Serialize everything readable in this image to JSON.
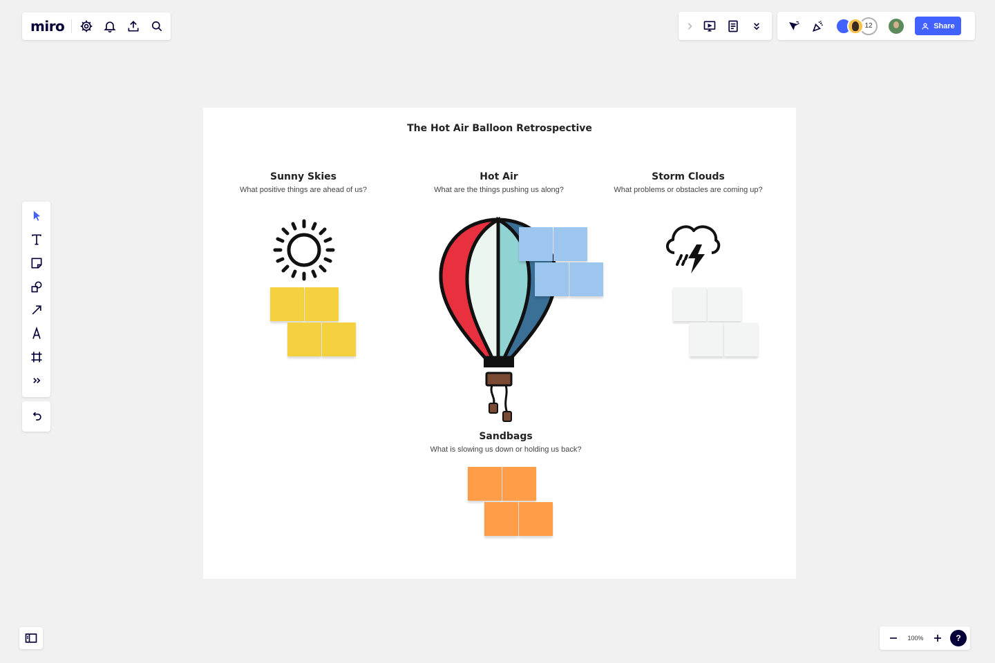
{
  "app": {
    "logo": "miro"
  },
  "toolbar": {
    "settings_icon": "gear-icon",
    "notifications_icon": "bell-icon",
    "export_icon": "upload-icon",
    "search_icon": "search-icon"
  },
  "collab": {
    "extra_count": "12",
    "share_label": "Share"
  },
  "zoom": {
    "value": "100%",
    "help": "?"
  },
  "board": {
    "title": "The Hot Air Balloon Retrospective",
    "sections": {
      "sunny": {
        "title": "Sunny Skies",
        "subtitle": "What positive things are ahead of us?"
      },
      "hotair": {
        "title": "Hot Air",
        "subtitle": "What are the things pushing us along?"
      },
      "storm": {
        "title": "Storm Clouds",
        "subtitle": "What problems or obstacles are coming up?"
      },
      "sandbags": {
        "title": "Sandbags",
        "subtitle": "What is slowing us down or holding us back?"
      }
    }
  },
  "colors": {
    "accent": "#4262ff",
    "yellow_note": "#f5d140",
    "blue_note": "#9dc6ee",
    "grey_note": "#f3f4f4",
    "orange_note": "#ff9d48",
    "balloon_red": "#e8303f",
    "balloon_teal": "#8fd3d3",
    "balloon_dark_blue": "#3a6f96"
  }
}
